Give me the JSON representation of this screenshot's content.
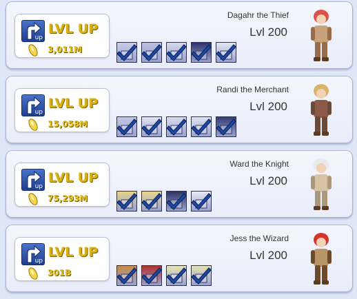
{
  "characters": [
    {
      "name": "Dagahr the Thief",
      "level": "Lvl 200",
      "button": "LVL UP",
      "up_text": "up",
      "cost": "3,011M",
      "skills": [
        {
          "icon": "thief-skill-1-icon",
          "bg": "#c9cde8"
        },
        {
          "icon": "thief-skill-2-icon",
          "bg": "#b9bfe0"
        },
        {
          "icon": "thief-skill-3-icon",
          "bg": "#d6d9ec"
        },
        {
          "icon": "thief-skill-4-icon",
          "bg": "#2e356c"
        },
        {
          "icon": "thief-skill-5-icon",
          "bg": "#e3e6f4"
        }
      ],
      "sprite": {
        "hair": "#e0504a",
        "body": "#c8a27a",
        "accent": "#9a6b48"
      }
    },
    {
      "name": "Randi the Merchant",
      "level": "Lvl 200",
      "button": "LVL UP",
      "up_text": "up",
      "cost": "15,058M",
      "skills": [
        {
          "icon": "merchant-skill-1-icon",
          "bg": "#c3c7e4"
        },
        {
          "icon": "merchant-skill-2-icon",
          "bg": "#e1e4f3"
        },
        {
          "icon": "merchant-skill-3-icon",
          "bg": "#d8dbef"
        },
        {
          "icon": "merchant-skill-4-icon",
          "bg": "#dfe2f2"
        },
        {
          "icon": "merchant-skill-5-icon",
          "bg": "#343b73"
        }
      ],
      "sprite": {
        "hair": "#d9b36b",
        "body": "#8d5a4a",
        "accent": "#6a4a3a"
      }
    },
    {
      "name": "Ward the Knight",
      "level": "Lvl 200",
      "button": "LVL UP",
      "up_text": "up",
      "cost": "75,293M",
      "skills": [
        {
          "icon": "knight-skill-1-icon",
          "bg": "#e6d28c"
        },
        {
          "icon": "knight-skill-2-icon",
          "bg": "#ead58e"
        },
        {
          "icon": "knight-skill-3-icon",
          "bg": "#2d3566"
        },
        {
          "icon": "knight-skill-4-icon",
          "bg": "#e7e9f5"
        }
      ],
      "sprite": {
        "hair": "#e9e9ee",
        "body": "#d8c4a4",
        "accent": "#a9987c"
      }
    },
    {
      "name": "Jess the Wizard",
      "level": "Lvl 200",
      "button": "LVL UP",
      "up_text": "up",
      "cost": "301B",
      "skills": [
        {
          "icon": "wizard-skill-1-icon",
          "bg": "#c58a4a"
        },
        {
          "icon": "wizard-skill-2-icon",
          "bg": "#b2302c"
        },
        {
          "icon": "wizard-skill-3-icon",
          "bg": "#e7e4b8"
        },
        {
          "icon": "wizard-skill-4-icon",
          "bg": "#e4e2b4"
        }
      ],
      "sprite": {
        "hair": "#d8342e",
        "body": "#b89466",
        "accent": "#6d4a2a"
      }
    }
  ],
  "colors": {
    "check": "#1e49a8",
    "check_outline": "#0d2456",
    "gold": "#e8c31a"
  }
}
